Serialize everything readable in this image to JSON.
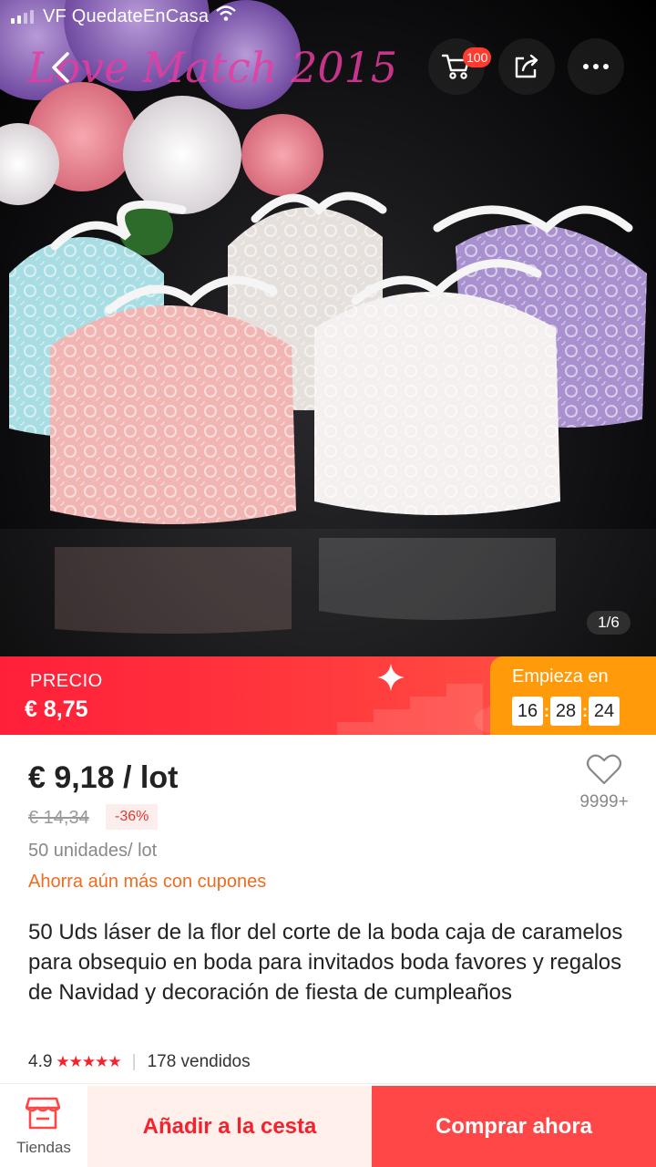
{
  "status_bar": {
    "carrier": "VF QuedateEnCasa"
  },
  "header": {
    "cart_badge": "100",
    "image_counter": "1/6",
    "watermark": "Love Match 2015"
  },
  "flash_banner": {
    "label": "PRECIO",
    "price": "€ 8,75",
    "countdown_label": "Empieza en",
    "hours": "16",
    "minutes": "28",
    "seconds": "24"
  },
  "product": {
    "price": "€ 9,18 / lot",
    "original_price": "€ 14,34",
    "discount": "-36%",
    "units": "50 unidades/ lot",
    "coupons_link": "Ahorra aún más con cupones",
    "title": "50 Uds láser de la flor del corte de la boda caja de caramelos para obsequio en boda para invitados boda favores y regalos de Navidad y decoración de fiesta de cumpleaños",
    "rating": "4.9",
    "stars": "★★★★★",
    "sold": "178 vendidos",
    "wishlist_count": "9999+"
  },
  "bottom_bar": {
    "stores_label": "Tiendas",
    "add_to_cart": "Añadir a la cesta",
    "buy_now": "Comprar ahora"
  },
  "colors": {
    "accent_red": "#ff4747",
    "banner_orange": "#ff9a0a",
    "coupon_orange": "#f06b1f"
  }
}
